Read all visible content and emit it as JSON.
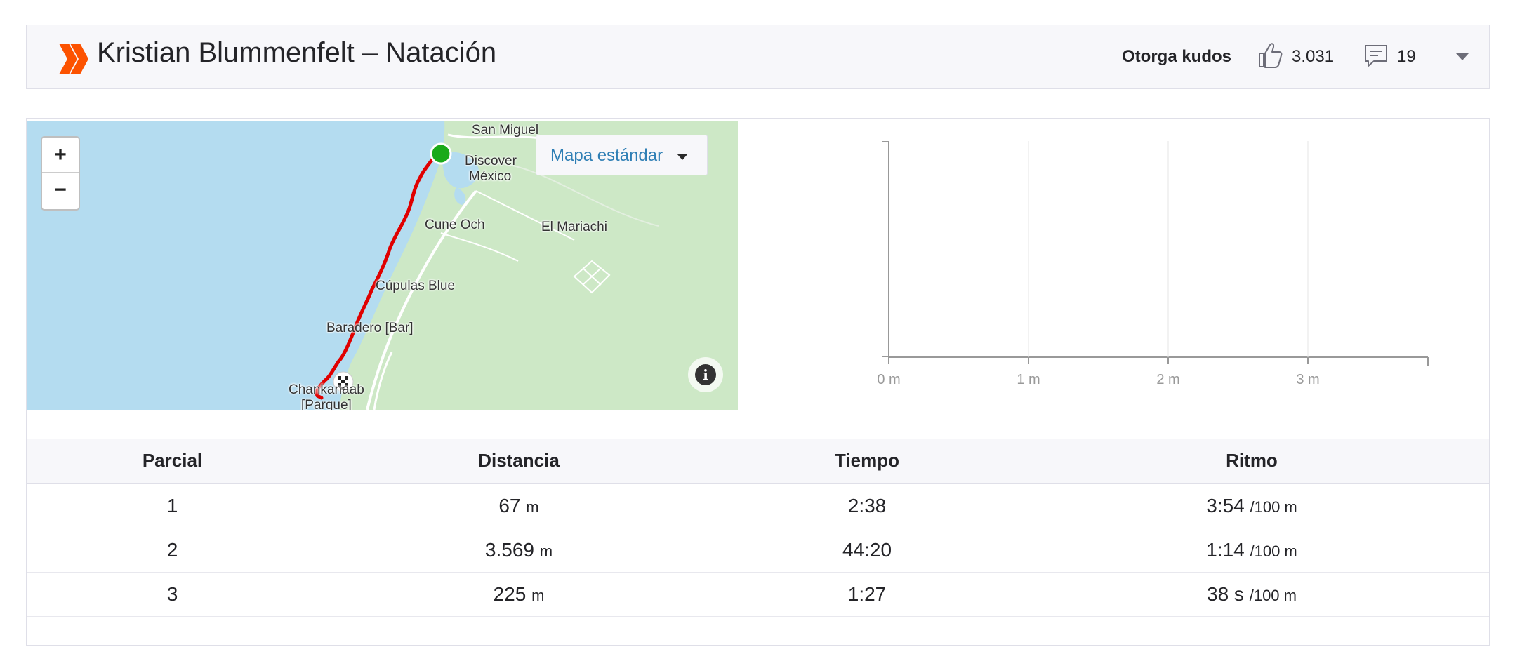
{
  "header": {
    "title": "Kristian Blummenfelt – Natación",
    "kudos_label": "Otorga kudos",
    "kudos_count": "3.031",
    "comment_count": "19",
    "logo_color": "#fc5200",
    "icons": {
      "kudos": "thumbs-up-icon",
      "comments": "comment-icon",
      "menu": "chevron-down-icon"
    }
  },
  "map": {
    "style_label": "Mapa estándar",
    "zoom_in": "+",
    "zoom_out": "−",
    "info": "i",
    "route_color": "#e00000",
    "start_color": "#1aaa1a",
    "labels": {
      "san_miguel": "San Miguel",
      "discover_line1": "Discover",
      "discover_line2": "México",
      "cune_och": "Cune Och",
      "el_mariachi": "El Mariachi",
      "cupulas": "Cúpulas Blue",
      "baradero": "Baradero [Bar]",
      "chankanaab_line1": "Chankanaab",
      "chankanaab_line2": "[Parque]"
    }
  },
  "chart_data": {
    "type": "line",
    "x_ticks": [
      "0 m",
      "1 m",
      "2 m",
      "3 m"
    ],
    "x": [],
    "series": [],
    "title": "",
    "xlabel": "",
    "ylabel": "",
    "grid": true
  },
  "splits": {
    "headers": [
      "Parcial",
      "Distancia",
      "Tiempo",
      "Ritmo"
    ],
    "rows": [
      {
        "split": "1",
        "distance": "67",
        "distance_unit": "m",
        "time": "2:38",
        "pace": "3:54",
        "pace_unit": "/100 m"
      },
      {
        "split": "2",
        "distance": "3.569",
        "distance_unit": "m",
        "time": "44:20",
        "pace": "1:14",
        "pace_unit": "/100 m"
      },
      {
        "split": "3",
        "distance": "225",
        "distance_unit": "m",
        "time": "1:27",
        "pace": "38 s",
        "pace_unit": "/100 m"
      }
    ]
  }
}
